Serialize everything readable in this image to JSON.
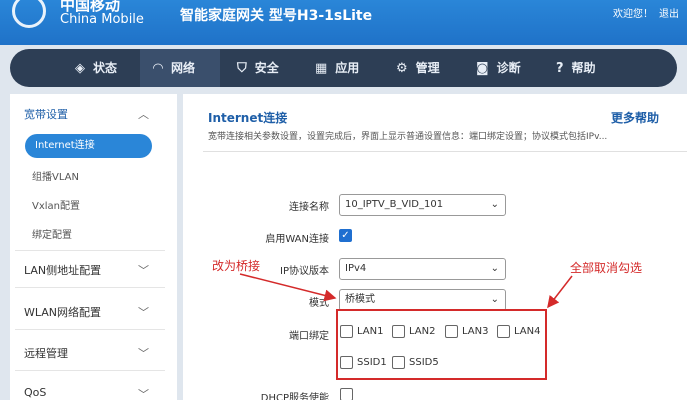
{
  "header": {
    "logo_cn": "中国移动",
    "logo_en": "China Mobile",
    "title": "智能家庭网关 型号H3-1sLite",
    "welcome": "欢迎您！",
    "logout": "退出"
  },
  "nav": {
    "items": [
      {
        "label": "状态",
        "icon": "layers-icon"
      },
      {
        "label": "网络",
        "icon": "wifi-icon"
      },
      {
        "label": "安全",
        "icon": "shield-icon"
      },
      {
        "label": "应用",
        "icon": "grid-icon"
      },
      {
        "label": "管理",
        "icon": "gear-icon"
      },
      {
        "label": "诊断",
        "icon": "camera-icon"
      },
      {
        "label": "帮助",
        "icon": "help-icon"
      }
    ],
    "active": "网络"
  },
  "sidebar": {
    "groups": [
      {
        "label": "宽带设置",
        "expanded": true,
        "items": [
          "Internet连接",
          "组播VLAN",
          "Vxlan配置",
          "绑定配置"
        ],
        "active": "Internet连接"
      },
      {
        "label": "LAN侧地址配置"
      },
      {
        "label": "WLAN网络配置"
      },
      {
        "label": "远程管理"
      },
      {
        "label": "QoS"
      }
    ]
  },
  "panel": {
    "title": "Internet连接",
    "more_help": "更多帮助",
    "description": "宽带连接相关参数设置，设置完成后，界面上显示普通设置信息：端口绑定设置；协议模式包括IPv..."
  },
  "form": {
    "connection_name_label": "连接名称",
    "connection_name_value": "10_IPTV_B_VID_101",
    "enable_wan_label": "启用WAN连接",
    "enable_wan_checked": true,
    "ip_version_label": "IP协议版本",
    "ip_version_value": "IPv4",
    "mode_label": "模式",
    "mode_value": "桥模式",
    "port_binding_label": "端口绑定",
    "ports": [
      {
        "label": "LAN1",
        "checked": false
      },
      {
        "label": "LAN2",
        "checked": false
      },
      {
        "label": "LAN3",
        "checked": false
      },
      {
        "label": "LAN4",
        "checked": false
      },
      {
        "label": "SSID1",
        "checked": false
      },
      {
        "label": "SSID5",
        "checked": false
      }
    ],
    "dhcp_label": "DHCP服务使能",
    "dhcp_checked": false
  },
  "annotations": {
    "change_to_bridge": "改为桥接",
    "uncheck_all": "全部取消勾选",
    "color": "#d42a2a"
  },
  "colors": {
    "header_blue": "#2a86d8",
    "nav_dark": "#2d3e55",
    "active_blue": "#2a86d8",
    "title_blue": "#1f5fa8"
  }
}
